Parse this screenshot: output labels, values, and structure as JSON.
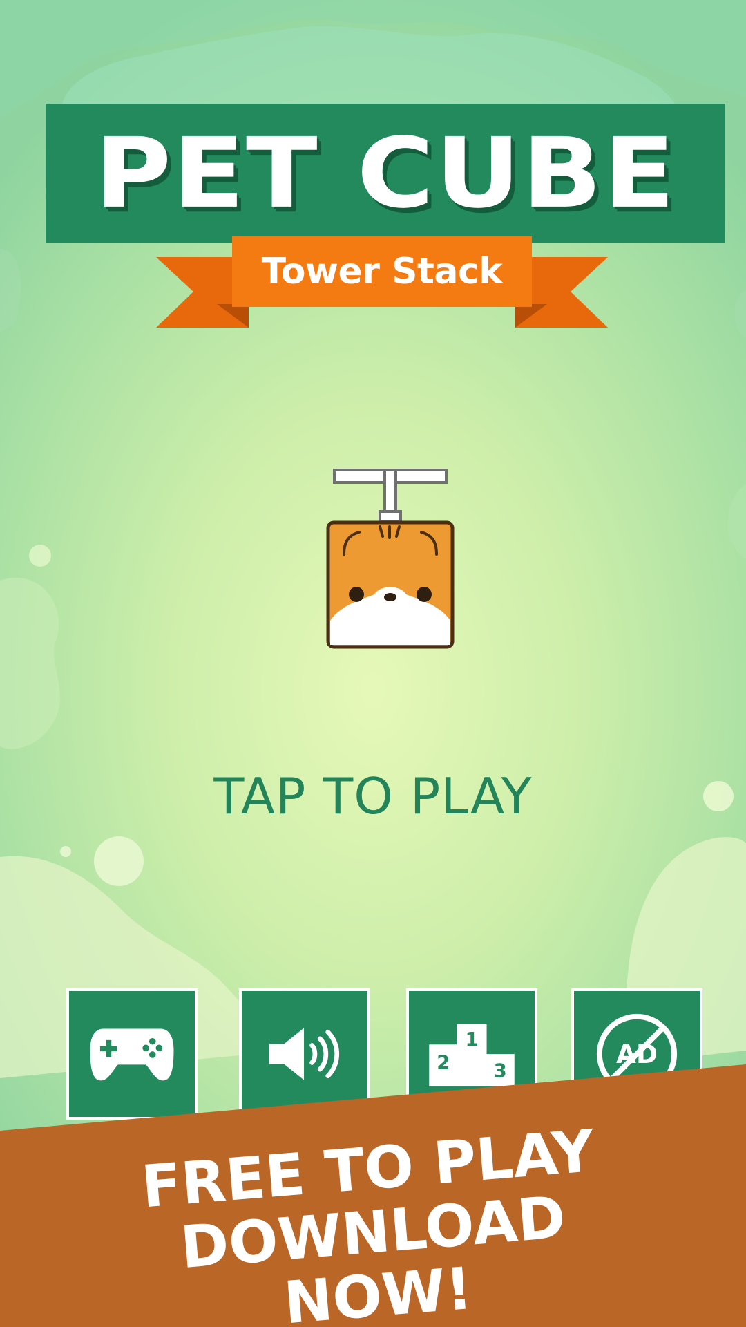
{
  "game": {
    "title": "PET CUBE",
    "subtitle": "Tower Stack",
    "prompt": "TAP TO PLAY"
  },
  "character": {
    "icon": "orange-cat-cube-with-propeller-icon"
  },
  "menu_buttons": [
    {
      "id": "games",
      "icon": "gamepad-icon"
    },
    {
      "id": "sound",
      "icon": "speaker-icon"
    },
    {
      "id": "leaderboard",
      "icon": "podium-icon",
      "podium_labels": [
        "1",
        "2",
        "3"
      ]
    },
    {
      "id": "no_ads",
      "icon": "no-ads-icon",
      "label": "AD"
    }
  ],
  "promo": {
    "line1": "FREE TO PLAY",
    "line2": "DOWNLOAD NOW!"
  },
  "colors": {
    "title_green": "#238a5e",
    "ribbon_orange": "#f47a12",
    "promo_brown": "#b96626",
    "text_green": "#23845a"
  }
}
